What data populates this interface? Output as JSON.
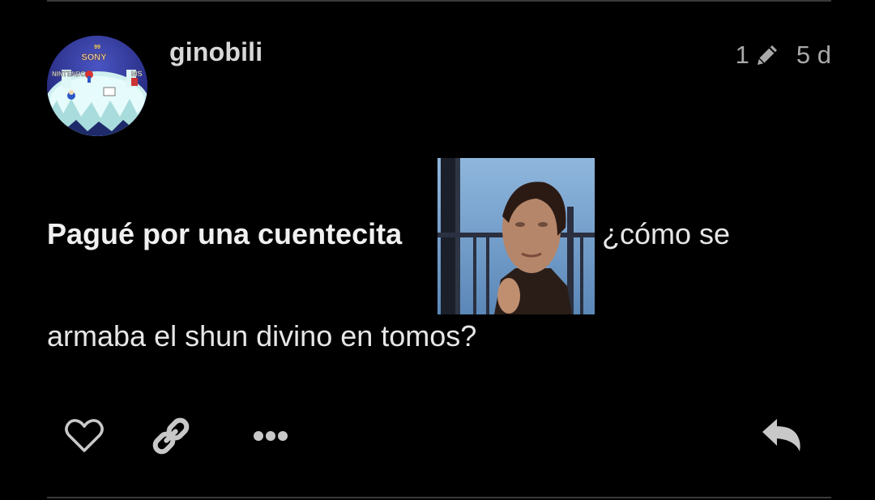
{
  "post": {
    "username": "ginobili",
    "edit_count": "1",
    "age": "5 d",
    "text_bold": "Pagué por una cuentecita",
    "text_after_image": "¿cómo se",
    "text_line2": "armaba el shun divino en tomos?"
  },
  "avatar": {
    "labels": [
      "99",
      "SONY",
      "NINTENDO",
      "MS"
    ]
  },
  "icons": {
    "edit": "pencil-icon",
    "like": "heart-icon",
    "share": "link-icon",
    "more": "more-options-icon",
    "reply": "reply-icon"
  },
  "colors": {
    "background": "#000000",
    "text": "#e6e6e6",
    "muted": "#a9a9a9",
    "icon": "#c8c8c8",
    "divider": "#3a3a3a"
  }
}
